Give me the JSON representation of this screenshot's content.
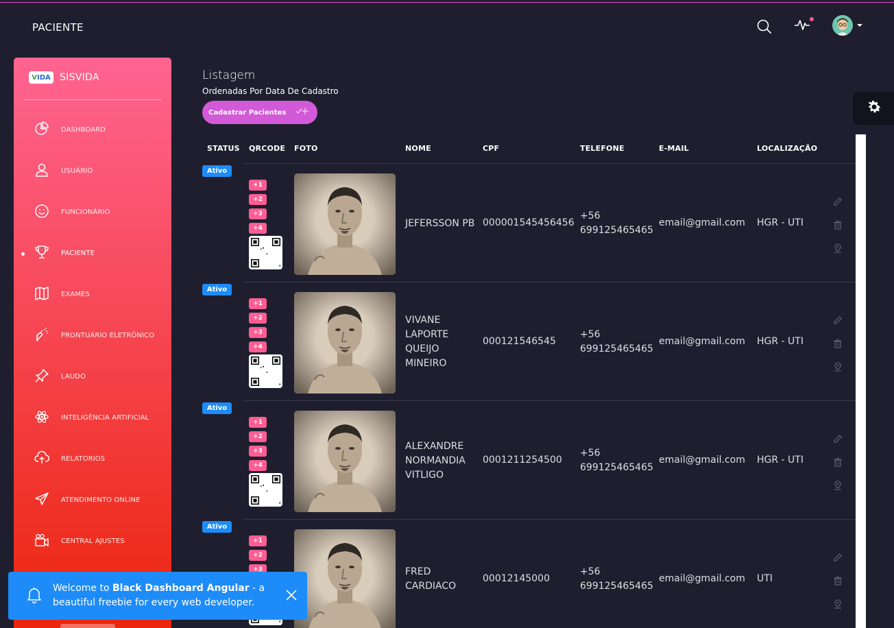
{
  "navbar": {
    "title": "PACIENTE"
  },
  "sidebar": {
    "logo_badge": "VIDA",
    "brand": "SISVIDA",
    "items": [
      {
        "label": "DASHBOARD",
        "icon": "pie-chart-icon"
      },
      {
        "label": "USUÁRIO",
        "icon": "user-icon"
      },
      {
        "label": "FUNCIONÁRIO",
        "icon": "smiley-icon"
      },
      {
        "label": "PACIENTE",
        "icon": "trophy-icon",
        "active": true
      },
      {
        "label": "EXAMES",
        "icon": "map-icon"
      },
      {
        "label": "PRONTUÁRIO ELETRÔNICO",
        "icon": "spray-icon"
      },
      {
        "label": "LAUDO",
        "icon": "pin-icon"
      },
      {
        "label": "INTELIGÊNCIA ARTIFICIAL",
        "icon": "atom-icon"
      },
      {
        "label": "RELATORIOS",
        "icon": "cloud-upload-icon"
      },
      {
        "label": "ATENDIMENTO ONLINE",
        "icon": "paper-plane-icon"
      },
      {
        "label": "CENTRAL AJUSTES",
        "icon": "video-camera-icon"
      }
    ]
  },
  "main": {
    "heading": "Listagem",
    "subheading": "Ordenadas Por Data De Cadastro",
    "add_button": "Cadastrar Pacientes",
    "add_button_icon": "user-plus-icon",
    "columns": [
      "STATUS",
      "QRCODE",
      "FOTO",
      "NOME",
      "CPF",
      "TELEFONE",
      "E-MAIL",
      "LOCALIZAÇÃO"
    ],
    "tags": [
      "+1",
      "+2",
      "+3",
      "+4"
    ],
    "rows": [
      {
        "status": "Ativo",
        "nome": [
          "JEFERSSON PB"
        ],
        "cpf": "000001545456456",
        "telefone": [
          "+56",
          "699125465465"
        ],
        "email": "email@gmail.com",
        "localizacao": "HGR - UTI"
      },
      {
        "status": "Ativo",
        "nome": [
          "VIVANE",
          "LAPORTE",
          "QUEIJO",
          "MINEIRO"
        ],
        "cpf": "000121546545",
        "telefone": [
          "+56",
          "699125465465"
        ],
        "email": "email@gmail.com",
        "localizacao": "HGR - UTI"
      },
      {
        "status": "Ativo",
        "nome": [
          "ALEXANDRE",
          "NORMANDIA",
          "VITLIGO"
        ],
        "cpf": "0001211254500",
        "telefone": [
          "+56",
          "699125465465"
        ],
        "email": "email@gmail.com",
        "localizacao": "HGR - UTI"
      },
      {
        "status": "Ativo",
        "nome": [
          "FRED",
          "CARDIACO"
        ],
        "cpf": "00012145000",
        "telefone": [
          "+56",
          "699125465465"
        ],
        "email": "email@gmail.com",
        "localizacao": "UTI"
      }
    ]
  },
  "toast": {
    "prefix": "Welcome to ",
    "bold": "Black Dashboard Angular",
    "suffix": " - a beautiful freebie for every web developer."
  },
  "colors": {
    "background": "#1e1e2f",
    "sidebar_top": "#ff6491",
    "sidebar_bottom": "#ec250d",
    "status_badge": "#1d8cf8",
    "tag": "#fd5d93",
    "button": "#d25ad8",
    "toast": "#1d8cf8"
  }
}
